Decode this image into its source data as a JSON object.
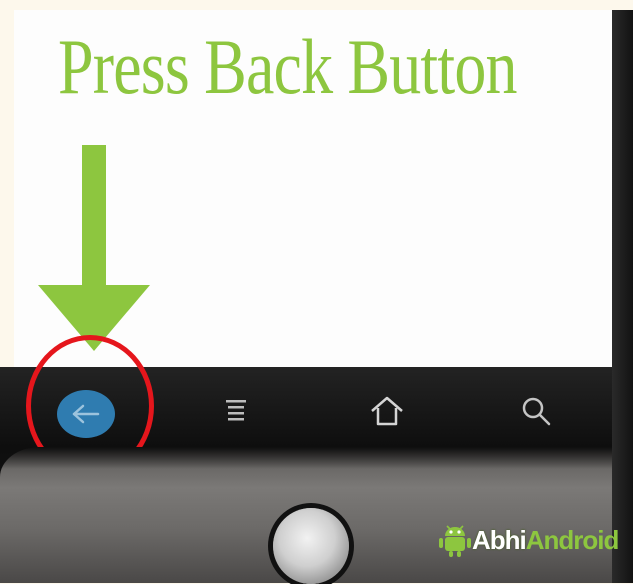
{
  "caption": {
    "text": "Press Back Button"
  },
  "navbar": {
    "buttons": [
      {
        "name": "back",
        "icon": "back-arrow-icon",
        "highlighted": true
      },
      {
        "name": "menu",
        "icon": "menu-icon"
      },
      {
        "name": "home",
        "icon": "home-icon"
      },
      {
        "name": "search",
        "icon": "search-icon"
      }
    ]
  },
  "branding": {
    "logo_part1": "Abhi",
    "logo_part2": "Android"
  },
  "colors": {
    "caption_green": "#8dc63f",
    "highlight_red": "#e5161c",
    "back_button_blue": "#2f7cb0"
  }
}
